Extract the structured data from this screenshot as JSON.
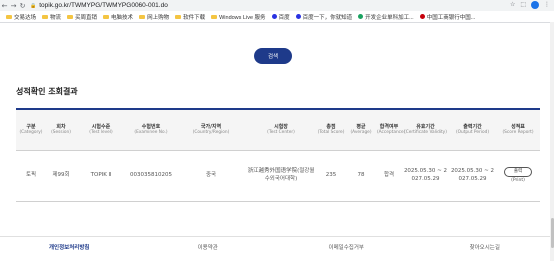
{
  "browser": {
    "url": "topik.go.kr/TWMYPG/TWMYPG0060-001.do",
    "bookmarks": [
      {
        "label": "交易达场",
        "icon": "folder"
      },
      {
        "label": "物流",
        "icon": "folder"
      },
      {
        "label": "买周直销",
        "icon": "folder"
      },
      {
        "label": "电脑技术",
        "icon": "folder"
      },
      {
        "label": "网上购物",
        "icon": "folder"
      },
      {
        "label": "软件下载",
        "icon": "folder"
      },
      {
        "label": "Windows Live 服务",
        "icon": "folder"
      },
      {
        "label": "百度",
        "icon": "site",
        "color": "#2932e1"
      },
      {
        "label": "百度一下，你就知道",
        "icon": "site",
        "color": "#2932e1"
      },
      {
        "label": "开发企业单科加工...",
        "icon": "site",
        "color": "#1aa260"
      },
      {
        "label": "中国工商银行中国...",
        "icon": "site",
        "color": "#c7000b"
      }
    ]
  },
  "search": {
    "button_label": "검색"
  },
  "results": {
    "title": "성적확인 조회결과",
    "columns": [
      {
        "ko": "구분",
        "en": "(Category)"
      },
      {
        "ko": "회차",
        "en": "(Session)"
      },
      {
        "ko": "시험수준",
        "en": "(Test level)"
      },
      {
        "ko": "수험번호",
        "en": "(Examinee No.)"
      },
      {
        "ko": "국가/지역",
        "en": "(Country/Region)"
      },
      {
        "ko": "시험장",
        "en": "(Test Center)"
      },
      {
        "ko": "총점",
        "en": "(Total Score)"
      },
      {
        "ko": "평균",
        "en": "(Average)"
      },
      {
        "ko": "합격여부",
        "en": "(Acceptance)"
      },
      {
        "ko": "유효기간",
        "en": "(Certificate Validity)"
      },
      {
        "ko": "출력기간",
        "en": "(Output Period)"
      },
      {
        "ko": "성적표",
        "en": "(Score Report)"
      }
    ],
    "row": {
      "category": "토픽",
      "session": "제99회",
      "level": "TOPIK Ⅱ",
      "examinee_no": "003035810205",
      "country": "중국",
      "test_center": "浙江越秀外国语学院(절강월수외국어대학)",
      "total_score": "235",
      "average": "78",
      "acceptance": "합격",
      "validity": "2025.05.30 ~ 2027.05.29",
      "output_period": "2025.05.30 ~ 2027.05.29",
      "print_label": "출력",
      "print_sub": "(Print)"
    }
  },
  "footer": {
    "privacy": "개인정보처리방침",
    "terms": "이용약관",
    "no_email": "이메일수집거부",
    "directions": "찾아오시는길"
  },
  "colors": {
    "accent": "#1e3a8a",
    "header_bg": "#f5f5f5"
  }
}
